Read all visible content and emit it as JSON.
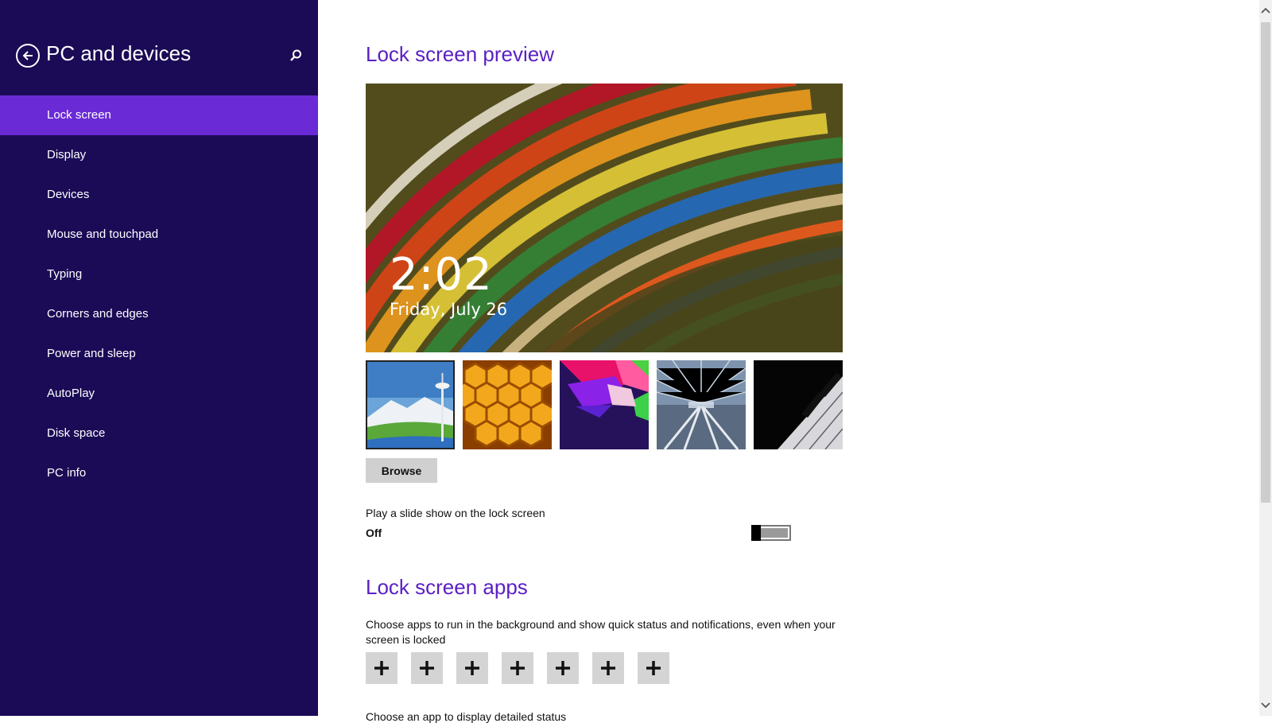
{
  "sidebar": {
    "title": "PC and devices",
    "back_icon": "back-arrow-circle-icon",
    "search_icon": "search-icon",
    "items": [
      {
        "label": "Lock screen",
        "active": true
      },
      {
        "label": "Display"
      },
      {
        "label": "Devices"
      },
      {
        "label": "Mouse and touchpad"
      },
      {
        "label": "Typing"
      },
      {
        "label": "Corners and edges"
      },
      {
        "label": "Power and sleep"
      },
      {
        "label": "AutoPlay"
      },
      {
        "label": "Disk space"
      },
      {
        "label": "PC info"
      }
    ]
  },
  "main": {
    "preview_title": "Lock screen preview",
    "preview": {
      "time": "2:02",
      "date": "Friday, July 26"
    },
    "thumbnails": [
      {
        "name": "space-needle",
        "selected": true
      },
      {
        "name": "honeycomb"
      },
      {
        "name": "geometric-shapes"
      },
      {
        "name": "tunnel"
      },
      {
        "name": "piano-keys"
      }
    ],
    "browse_label": "Browse",
    "slideshow": {
      "label": "Play a slide show on the lock screen",
      "state": "Off"
    },
    "apps_title": "Lock screen apps",
    "apps_description": "Choose apps to run in the background and show quick status and notifications, even when your screen is locked",
    "app_slot_count": 7,
    "detail_label": "Choose an app to display detailed status"
  },
  "colors": {
    "sidebar_bg": "#1b0b56",
    "sidebar_active": "#6a2ad6",
    "heading": "#5a1fc4"
  }
}
